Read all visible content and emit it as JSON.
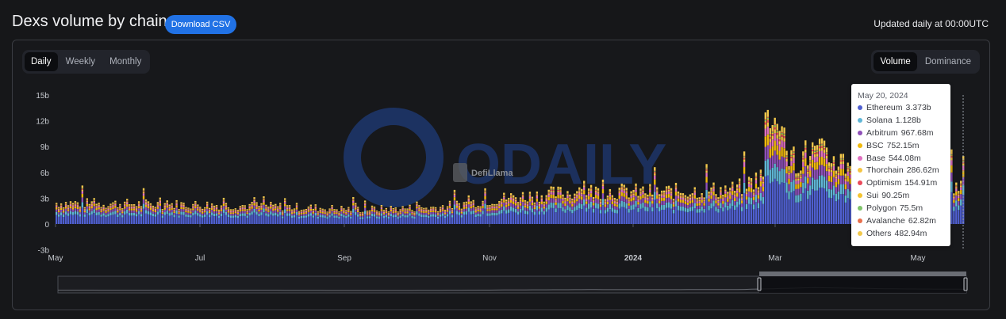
{
  "header": {
    "title": "Dexs volume by chain",
    "download_label": "Download CSV",
    "updated_text": "Updated daily at 00:00UTC"
  },
  "toggles": {
    "period": [
      "Daily",
      "Weekly",
      "Monthly"
    ],
    "period_selected": "Daily",
    "mode": [
      "Volume",
      "Dominance"
    ],
    "mode_selected": "Volume"
  },
  "watermarks": {
    "brand": "ODAILY",
    "logo": "DefiLlama"
  },
  "colors": {
    "Ethereum": "#4f5fd0",
    "Solana": "#5fb6d6",
    "Arbitrum": "#8e4fb8",
    "BSC": "#f0b90b",
    "Base": "#e06fc0",
    "Thorchain": "#f5c542",
    "Optimism": "#ea4a5a",
    "Sui": "#f4c430",
    "Polygon": "#7fc46a",
    "Avalanche": "#e8704d",
    "Others": "#f2c84b",
    "axis_text": "#c5c8ce",
    "grid": "#2a2c31",
    "accent": "#2172e5"
  },
  "chart_data": {
    "type": "bar",
    "stacked": true,
    "y_ticks": [
      "15b",
      "12b",
      "9b",
      "6b",
      "3b",
      "0",
      "-3b"
    ],
    "ylim": [
      -3,
      15
    ],
    "y_unit": "billions USD",
    "x_ticks": [
      "May",
      "Jul",
      "Sep",
      "Nov",
      "2024",
      "Mar",
      "May"
    ],
    "x_range": [
      "2023-05-01",
      "2024-05-20"
    ],
    "approx_total_by_month": {
      "2023-05": 2.3,
      "2023-06": 2.2,
      "2023-07": 2.1,
      "2023-08": 1.9,
      "2023-09": 1.6,
      "2023-10": 1.8,
      "2023-11": 2.9,
      "2023-12": 3.6,
      "2024-01": 3.5,
      "2024-02": 3.8,
      "2024-03": 7.8,
      "2024-04": 5.3,
      "2024-05": 4.3
    },
    "peak": {
      "month": "2024-03",
      "value": 13.9
    },
    "tooltip": {
      "date": "May 20, 2024",
      "series": [
        {
          "name": "Ethereum",
          "label": "3.373b",
          "value": 3.373
        },
        {
          "name": "Solana",
          "label": "1.128b",
          "value": 1.128
        },
        {
          "name": "Arbitrum",
          "label": "967.68m",
          "value": 0.96768
        },
        {
          "name": "BSC",
          "label": "752.15m",
          "value": 0.75215
        },
        {
          "name": "Base",
          "label": "544.08m",
          "value": 0.54408
        },
        {
          "name": "Thorchain",
          "label": "286.62m",
          "value": 0.28662
        },
        {
          "name": "Optimism",
          "label": "154.91m",
          "value": 0.15491
        },
        {
          "name": "Sui",
          "label": "90.25m",
          "value": 0.09025
        },
        {
          "name": "Polygon",
          "label": "75.5m",
          "value": 0.0755
        },
        {
          "name": "Avalanche",
          "label": "62.82m",
          "value": 0.06282
        },
        {
          "name": "Others",
          "label": "482.94m",
          "value": 0.48294
        }
      ]
    },
    "grid": false,
    "legend": "tooltip"
  }
}
